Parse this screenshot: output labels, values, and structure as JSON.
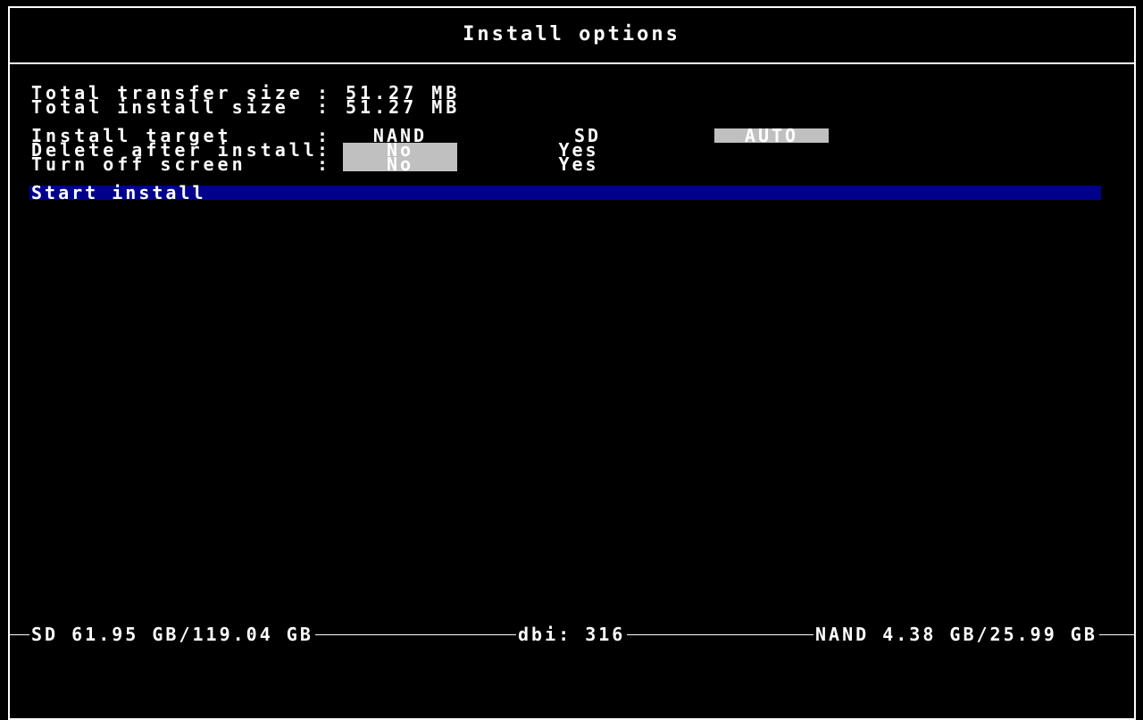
{
  "header": {
    "title": "Install options"
  },
  "summary": {
    "transfer_label": "Total transfer size",
    "transfer_value": "51.27 MB",
    "install_label": "Total install size",
    "install_value": "51.27 MB"
  },
  "options": {
    "target_label": "Install target",
    "target_nand": "NAND",
    "target_sd": "SD",
    "target_auto": "AUTO",
    "delete_label": "Delete after install",
    "delete_no": "No",
    "delete_yes": "Yes",
    "screen_label": "Turn off screen",
    "screen_no": "No",
    "screen_yes": "Yes",
    "separator": ":"
  },
  "actions": {
    "start_label": "Start install"
  },
  "footer": {
    "sd_info": "SD 61.95 GB/119.04 GB",
    "dbi_info": "dbi: 316",
    "nand_info": "NAND 4.38 GB/25.99 GB"
  }
}
